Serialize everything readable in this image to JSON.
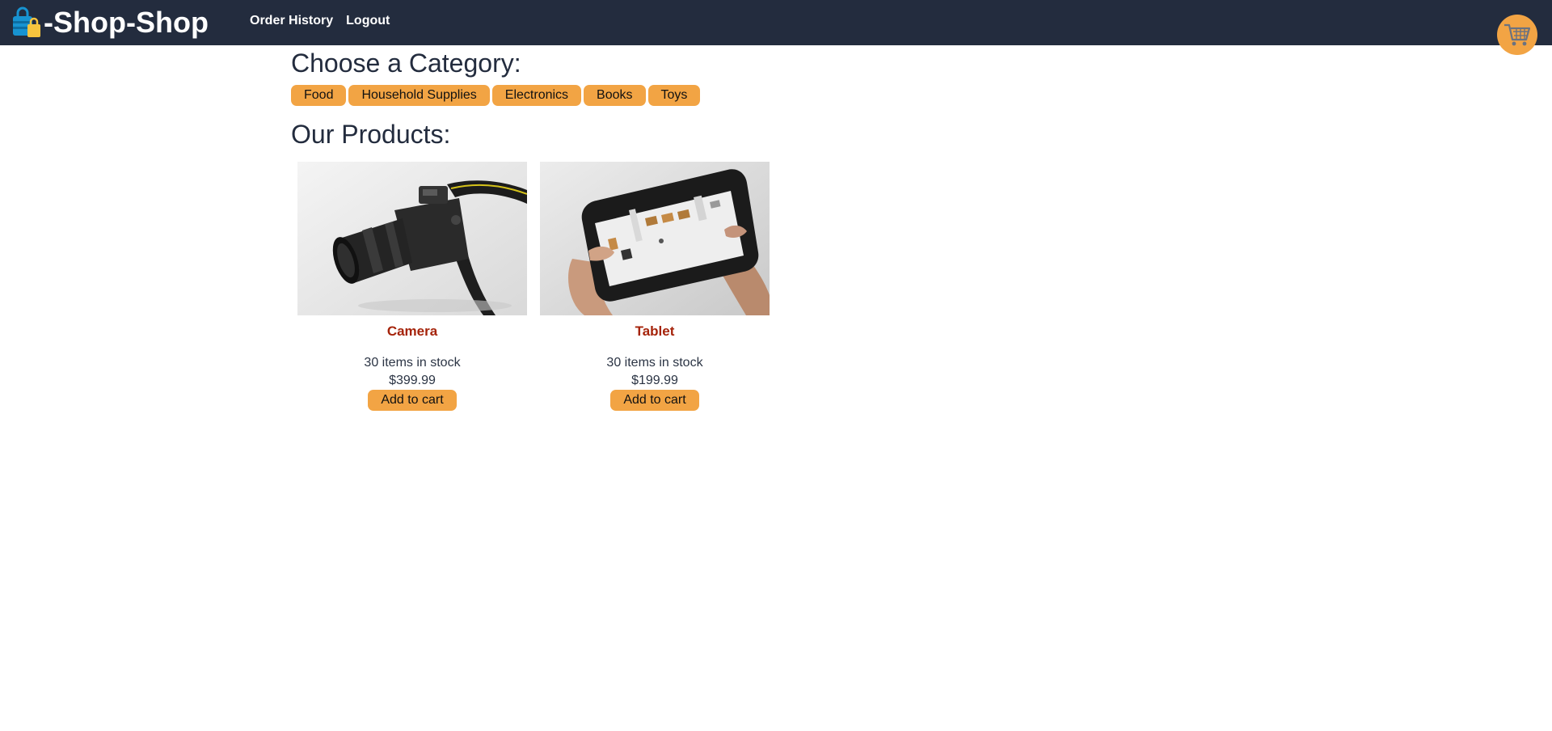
{
  "header": {
    "brand_title": "-Shop-Shop",
    "brand_icon": "shopping-bags-icon",
    "nav": [
      {
        "label": "Order History"
      },
      {
        "label": "Logout"
      }
    ],
    "cart_icon": "shopping-cart-icon"
  },
  "categories": {
    "title": "Choose a Category:",
    "items": [
      "Food",
      "Household Supplies",
      "Electronics",
      "Books",
      "Toys"
    ]
  },
  "products": {
    "title": "Our Products:",
    "items": [
      {
        "name": "Camera",
        "stock": "30 items in stock",
        "price": "$399.99",
        "button": "Add to cart",
        "image": "camera-photo"
      },
      {
        "name": "Tablet",
        "stock": "30 items in stock",
        "price": "$199.99",
        "button": "Add to cart",
        "image": "tablet-photo"
      }
    ]
  },
  "colors": {
    "header_bg": "#232c3e",
    "accent": "#f2a444",
    "product_name": "#a5230a"
  }
}
